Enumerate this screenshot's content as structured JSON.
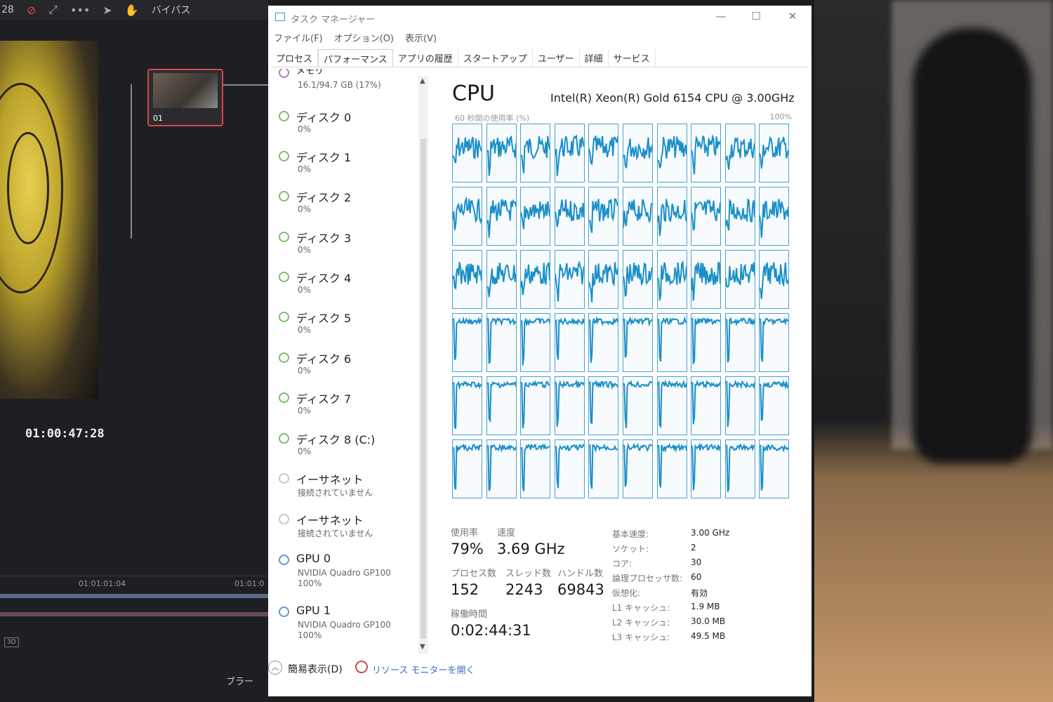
{
  "editor": {
    "zoom_fragment": "28",
    "bypass_label": "バイパス",
    "node_label": "01",
    "timecode": "01:00:47:28",
    "ruler_ticks": [
      "01:01:01:04",
      "01:01:0"
    ],
    "badge_3d": "3D",
    "bottom_label": "ブラー"
  },
  "window": {
    "title": "タスク マネージャー",
    "controls": [
      "—",
      "☐",
      "✕"
    ]
  },
  "menu": [
    "ファイル(F)",
    "オプション(O)",
    "表示(V)"
  ],
  "tabs": [
    "プロセス",
    "パフォーマンス",
    "アプリの履歴",
    "スタートアップ",
    "ユーザー",
    "詳細",
    "サービス"
  ],
  "active_tab": "パフォーマンス",
  "sidebar": {
    "items": [
      {
        "name": "メモリ",
        "sub": "16.1/94.7 GB (17%)",
        "sub2": "",
        "icon": "memory-icon",
        "color": "purple"
      },
      {
        "name": "ディスク 0",
        "sub": "0%",
        "sub2": "",
        "icon": "disk-icon",
        "color": "green"
      },
      {
        "name": "ディスク 1",
        "sub": "0%",
        "sub2": "",
        "icon": "disk-icon",
        "color": "green"
      },
      {
        "name": "ディスク 2",
        "sub": "0%",
        "sub2": "",
        "icon": "disk-icon",
        "color": "green"
      },
      {
        "name": "ディスク 3",
        "sub": "0%",
        "sub2": "",
        "icon": "disk-icon",
        "color": "green"
      },
      {
        "name": "ディスク 4",
        "sub": "0%",
        "sub2": "",
        "icon": "disk-icon",
        "color": "green"
      },
      {
        "name": "ディスク 5",
        "sub": "0%",
        "sub2": "",
        "icon": "disk-icon",
        "color": "green"
      },
      {
        "name": "ディスク 6",
        "sub": "0%",
        "sub2": "",
        "icon": "disk-icon",
        "color": "green"
      },
      {
        "name": "ディスク 7",
        "sub": "0%",
        "sub2": "",
        "icon": "disk-icon",
        "color": "green"
      },
      {
        "name": "ディスク 8 (C:)",
        "sub": "0%",
        "sub2": "",
        "icon": "disk-icon",
        "color": "green"
      },
      {
        "name": "イーサネット",
        "sub": "接続されていません",
        "sub2": "",
        "icon": "ethernet-icon",
        "color": "grey"
      },
      {
        "name": "イーサネット",
        "sub": "接続されていません",
        "sub2": "",
        "icon": "ethernet-icon",
        "color": "grey"
      },
      {
        "name": "GPU 0",
        "sub": "NVIDIA Quadro GP100",
        "sub2": "100%",
        "icon": "gpu-icon",
        "color": "blue"
      },
      {
        "name": "GPU 1",
        "sub": "NVIDIA Quadro GP100",
        "sub2": "100%",
        "icon": "gpu-icon",
        "color": "blue"
      }
    ]
  },
  "cpu": {
    "title": "CPU",
    "model": "Intel(R) Xeon(R) Gold 6154 CPU @ 3.00GHz",
    "graph_label": "60 秒間の使用率 (%)",
    "graph_max": "100%",
    "logical_processor_graphs": 60,
    "graph_color": "#1a8fc8",
    "stats": {
      "usage_label": "使用率",
      "usage": "79%",
      "speed_label": "速度",
      "speed": "3.69 GHz",
      "processes_label": "プロセス数",
      "processes": "152",
      "threads_label": "スレッド数",
      "threads": "2243",
      "handles_label": "ハンドル数",
      "handles": "69843",
      "uptime_label": "稼働時間",
      "uptime": "0:02:44:31"
    },
    "details": [
      {
        "key": "基本速度:",
        "value": "3.00 GHz"
      },
      {
        "key": "ソケット:",
        "value": "2"
      },
      {
        "key": "コア:",
        "value": "30"
      },
      {
        "key": "論理プロセッサ数:",
        "value": "60"
      },
      {
        "key": "仮想化:",
        "value": "有効"
      },
      {
        "key": "L1 キャッシュ:",
        "value": "1.9 MB"
      },
      {
        "key": "L2 キャッシュ:",
        "value": "30.0 MB"
      },
      {
        "key": "L3 キャッシュ:",
        "value": "49.5 MB"
      }
    ]
  },
  "footer": {
    "simple_view": "簡易表示(D)",
    "resource_monitor": "リソース モニターを開く"
  }
}
